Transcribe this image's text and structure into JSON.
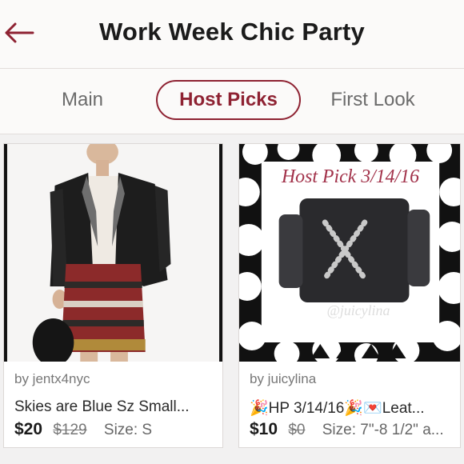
{
  "header": {
    "title": "Work Week Chic Party",
    "back_icon": "back-arrow-icon",
    "accent": "#8e2232"
  },
  "tabs": [
    {
      "label": "Main",
      "active": false
    },
    {
      "label": "Host Picks",
      "active": true
    },
    {
      "label": "First Look",
      "active": false
    }
  ],
  "listings": [
    {
      "seller": "by jentx4nyc",
      "title": "Skies are Blue Sz Small...",
      "price": "$20",
      "original_price": "$129",
      "size": "Size: S"
    },
    {
      "seller": "by juicylina",
      "title": "🎉HP 3/14/16🎉💌Leat...",
      "price": "$10",
      "original_price": "$0",
      "size": "Size: 7\"-8 1/2\" a...",
      "image_caption": "Host Pick 3/14/16",
      "image_watermark": "@juicylina"
    }
  ]
}
